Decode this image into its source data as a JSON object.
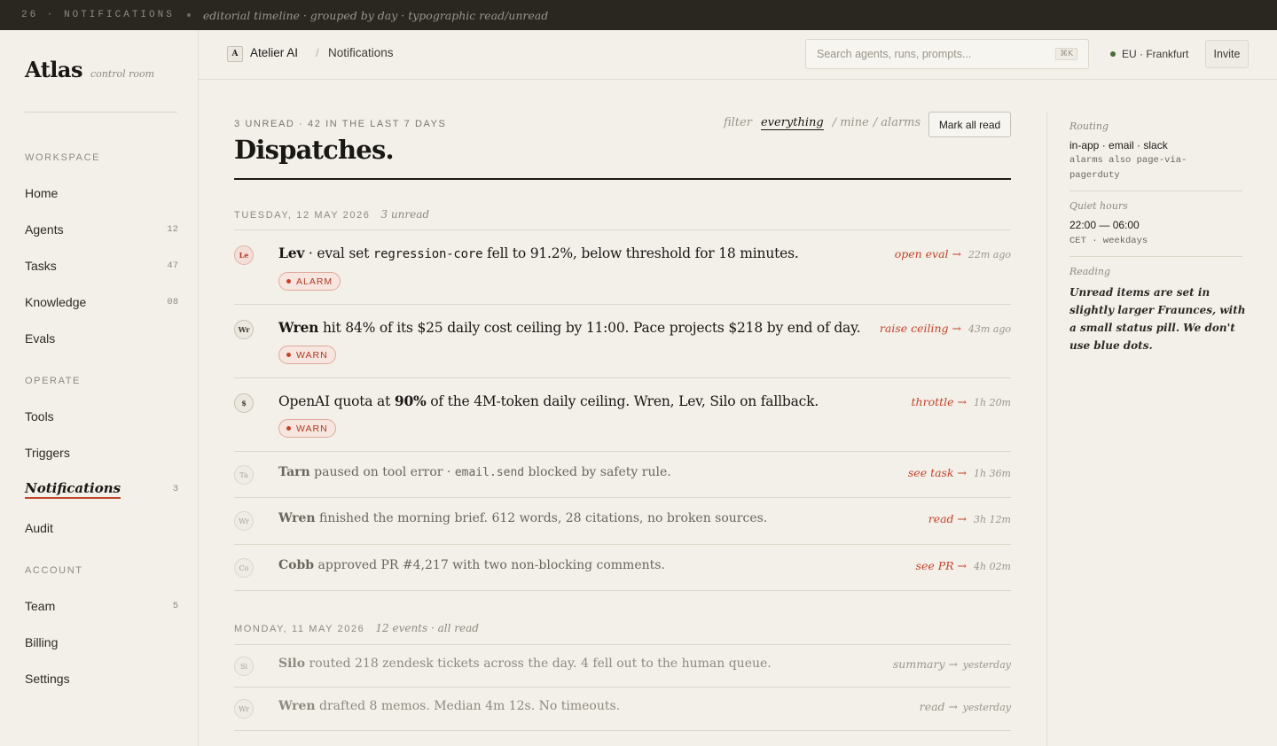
{
  "topband": {
    "count": "26 · NOTIFICATIONS",
    "description": "editorial timeline · grouped by day · typographic read/unread"
  },
  "sidebar": {
    "brand": "Atlas",
    "tagline": "control room",
    "sections": [
      {
        "label": "WORKSPACE",
        "items": [
          {
            "label": "Home",
            "count": ""
          },
          {
            "label": "Agents",
            "count": "12"
          },
          {
            "label": "Tasks",
            "count": "47"
          },
          {
            "label": "Knowledge",
            "count": "08"
          },
          {
            "label": "Evals",
            "count": ""
          }
        ]
      },
      {
        "label": "OPERATE",
        "items": [
          {
            "label": "Tools",
            "count": ""
          },
          {
            "label": "Triggers",
            "count": ""
          },
          {
            "label": "Notifications",
            "count": "3",
            "active": true
          },
          {
            "label": "Audit",
            "count": ""
          }
        ]
      },
      {
        "label": "ACCOUNT",
        "items": [
          {
            "label": "Team",
            "count": "5"
          },
          {
            "label": "Billing",
            "count": ""
          },
          {
            "label": "Settings",
            "count": ""
          }
        ]
      }
    ]
  },
  "header": {
    "workspace_initial": "A",
    "workspace_name": "Atelier AI",
    "separator": "/",
    "page": "Notifications",
    "search_placeholder": "Search agents, runs, prompts...",
    "search_shortcut": "⌘K",
    "region": "EU · Frankfurt",
    "invite": "Invite"
  },
  "main": {
    "counts": "3 UNREAD · 42 IN THE LAST 7 DAYS",
    "title": "Dispatches.",
    "filters": {
      "label": "filter",
      "active": "everything",
      "mine": "/ mine",
      "alarms": "/ alarms"
    },
    "mark_all": "Mark all read",
    "days": [
      {
        "day": "TUESDAY, 12 MAY 2026",
        "note": "3 unread",
        "items": [
          {
            "avatar": "Le",
            "state": "alarm",
            "who": "Lev",
            "pre": " · eval set ",
            "code": "regression-core",
            "post": " fell to 91.2%, below threshold for 18 minutes.",
            "pill": "ALARM",
            "action": "open eval →",
            "time": "22m ago"
          },
          {
            "avatar": "Wr",
            "state": "unread",
            "who": "Wren",
            "pre": " hit 84% of its $25 daily cost ceiling by 11:00. Pace projects $218 by end of day.",
            "code": "",
            "post": "",
            "pill": "WARN",
            "action": "raise ceiling →",
            "time": "43m ago"
          },
          {
            "avatar": "$",
            "state": "unread",
            "lead": "OpenAI quota at ",
            "who": "90%",
            "pre": " of the 4M-token daily ceiling. Wren, Lev, Silo on fallback.",
            "code": "",
            "post": "",
            "pill": "WARN",
            "action": "throttle →",
            "time": "1h 20m"
          },
          {
            "avatar": "Ta",
            "state": "read",
            "who": "Tarn",
            "pre": " paused on tool error · ",
            "code": "email.send",
            "post": " blocked by safety rule.",
            "action": "see task →",
            "time": "1h 36m"
          },
          {
            "avatar": "Wr",
            "state": "read",
            "who": "Wren",
            "pre": " finished the morning brief. 612 words, 28 citations, no broken sources.",
            "code": "",
            "post": "",
            "action": "read →",
            "time": "3h 12m"
          },
          {
            "avatar": "Co",
            "state": "read",
            "who": "Cobb",
            "pre": " approved PR #4,217 with two non-blocking comments.",
            "code": "",
            "post": "",
            "action": "see PR →",
            "time": "4h 02m"
          }
        ]
      },
      {
        "day": "MONDAY, 11 MAY 2026",
        "note": "12 events · all read",
        "items": [
          {
            "avatar": "Si",
            "state": "faded",
            "who": "Silo",
            "pre": " routed 218 zendesk tickets across the day. 4 fell out to the human queue.",
            "code": "",
            "post": "",
            "action": "summary →",
            "time": "yesterday"
          },
          {
            "avatar": "Wr",
            "state": "faded",
            "who": "Wren",
            "pre": " drafted 8 memos. Median 4m 12s. No timeouts.",
            "code": "",
            "post": "",
            "action": "read →",
            "time": "yesterday"
          }
        ]
      }
    ]
  },
  "panel": {
    "routing_label": "Routing",
    "routing_value": "in-app · email · slack",
    "routing_note": "alarms also page-via-pagerduty",
    "quiet_label": "Quiet hours",
    "quiet_value": "22:00 — 06:00",
    "quiet_note": "CET · weekdays",
    "reading_label": "Reading",
    "reading_note": "Unread items are set in slightly larger Fraunces, with a small status pill. We don't use blue dots."
  },
  "colors": {
    "accent": "#c2442a",
    "ink": "#1a1814",
    "paper": "#f3f0ea",
    "band": "#2a2721",
    "status_ok": "#4c6b3a"
  }
}
